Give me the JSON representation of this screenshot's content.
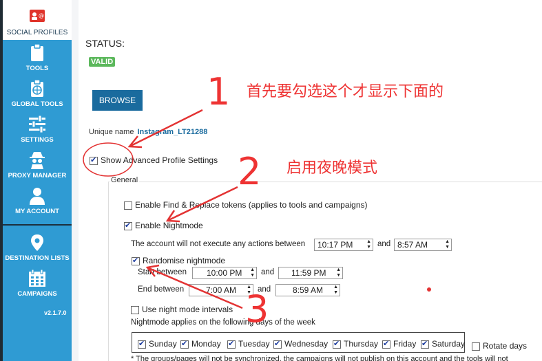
{
  "sidebar": {
    "items": [
      {
        "label": "SOCIAL PROFILES",
        "icon": "social-profiles-icon"
      },
      {
        "label": "TOOLS",
        "icon": "clipboard-icon"
      },
      {
        "label": "GLOBAL TOOLS",
        "icon": "globe-clipboard-icon"
      },
      {
        "label": "SETTINGS",
        "icon": "sliders-icon"
      },
      {
        "label": "PROXY MANAGER",
        "icon": "spy-icon"
      },
      {
        "label": "MY ACCOUNT",
        "icon": "user-icon"
      },
      {
        "label": "DESTINATION LISTS",
        "icon": "map-pin-icon"
      },
      {
        "label": "CAMPAIGNS",
        "icon": "calendar-icon"
      }
    ],
    "version": "v2.1.7.0"
  },
  "status": {
    "label": "STATUS:",
    "badge": "VALID"
  },
  "browse_label": "BROWSE",
  "unique_name": {
    "label": "Unique name",
    "value": "Instagram_LT21288"
  },
  "show_advanced": {
    "label": "Show Advanced Profile Settings",
    "checked": true
  },
  "general": {
    "legend": "General",
    "find_replace": {
      "label": "Enable Find & Replace tokens (applies to tools and campaigns)",
      "checked": false
    },
    "nightmode": {
      "label": "Enable Nightmode",
      "checked": true
    },
    "between_text": "The account will not execute any actions between",
    "and_text": "and",
    "night_start": "10:17 PM",
    "night_end": "8:57 AM",
    "randomise": {
      "label": "Randomise nightmode",
      "checked": true
    },
    "start_between_label": "Start between",
    "start_from": "10:00 PM",
    "start_to": "11:59 PM",
    "end_between_label": "End between",
    "end_from": "7:00 AM",
    "end_to": "8:59 AM",
    "intervals": {
      "label": "Use night mode intervals",
      "checked": false
    },
    "applies_text": "Nightmode applies on the following days of the week",
    "days": [
      {
        "label": "Sunday",
        "checked": true
      },
      {
        "label": "Monday",
        "checked": true
      },
      {
        "label": "Tuesday",
        "checked": true
      },
      {
        "label": "Wednesday",
        "checked": true
      },
      {
        "label": "Thursday",
        "checked": true
      },
      {
        "label": "Friday",
        "checked": true
      },
      {
        "label": "Saturday",
        "checked": true
      }
    ],
    "rotate_days": {
      "label": "Rotate days",
      "checked": false
    },
    "footnote": "* The groups/pages will not be synchronized, the campaigns will not publish on this account and the tools will not"
  },
  "annotations": {
    "note1": "首先要勾选这个才显示下面的",
    "note2": "启用夜晚模式",
    "num1": "1",
    "num2": "2",
    "num3": "3",
    "color": "#e33333"
  }
}
